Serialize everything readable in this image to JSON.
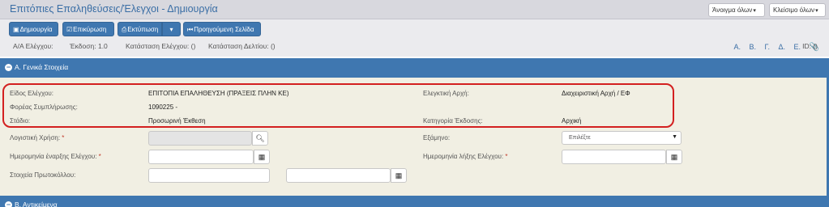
{
  "header": {
    "title": "Επιτόπιες Επαληθεύσεις/Έλεγχοι - Δημιουργία",
    "open_all": "Άνοιγμα όλων",
    "close_all": "Κλείσιμο όλων"
  },
  "toolbar": {
    "create": "Δημιουργία",
    "confirm": "Επικύρωση",
    "print": "Εκτύπωση",
    "previous_page": "Προηγούμενη Σελίδα",
    "letters": [
      "Α.",
      "Β.",
      "Γ.",
      "Δ.",
      "Ε."
    ]
  },
  "info": {
    "aa": "Α/Α Ελέγχου:",
    "version": "Έκδοση: 1.0",
    "check_status": "Κατάσταση Ελέγχου: ()",
    "report_status": "Κατάσταση Δελτίου: ()",
    "id": "ID: ()"
  },
  "section_a": {
    "title": "Α. Γενικά Στοιχεία",
    "check_type_label": "Είδος Ελέγχου:",
    "check_type_value": "ΕΠΙΤΟΠΙΑ ΕΠΑΛΗΘΕΥΣΗ (ΠΡΑΞΕΙΣ ΠΛΗΝ ΚΕ)",
    "auditing_authority_label": "Ελεγκτική Αρχή:",
    "auditing_authority_value": "Διαχειριστική Αρχή / ΕΦ",
    "filling_body_label": "Φορέας Συμπλήρωσης:",
    "filling_body_value": "1090225 -",
    "stage_label": "Στάδιο:",
    "stage_value": "Προσωρινή Έκθεση",
    "issue_category_label": "Κατηγορία Έκδοσης:",
    "issue_category_value": "Αρχική",
    "fiscal_year_label": "Λογιστική Χρήση:",
    "semester_label": "Εξάμηνο:",
    "semester_placeholder": "Επιλέξτε",
    "start_date_label": "Ημερομηνία έναρξης Ελέγχου:",
    "end_date_label": "Ημερομηνία λήξης Ελέγχου:",
    "protocol_label": "Στοιχεία Πρωτοκόλλου:",
    "required_mark": "*"
  },
  "section_b": {
    "title": "Β. Αντικείμενα"
  }
}
